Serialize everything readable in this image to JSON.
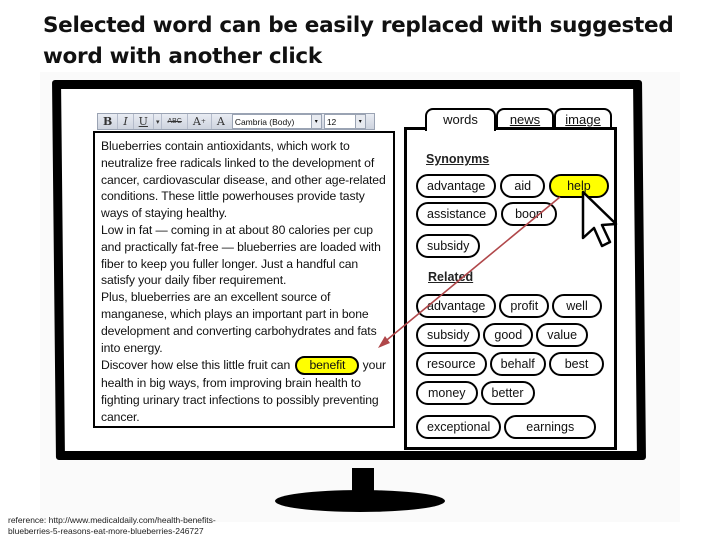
{
  "title": "Selected word can be easily replaced with suggested word with another click",
  "toolbar": {
    "bold": "B",
    "italic": "I",
    "underline": "U",
    "underline_dropdown": "▾",
    "strikethrough": "ABC",
    "grow_font": "A",
    "font_color": "A",
    "font_name": "Cambria (Body)",
    "font_size": "12",
    "dropdown_arrow": "▾"
  },
  "editor": {
    "paragraphs": [
      "Blueberries contain antioxidants, which work to neutralize free radicals linked to the development of cancer, cardiovascular disease, and other age-related conditions. These little powerhouses provide tasty ways of staying healthy.",
      "Low in fat — coming in at about 80 calories per cup and practically fat-free — blueberries are loaded with fiber to keep you fuller longer. Just a handful can satisfy your daily fiber requirement.",
      "Plus, blueberries are an excellent source of manganese, which plays an important part in bone development and converting carbohydrates and fats into energy."
    ],
    "last_before": "Discover how else this little fruit can",
    "selected_word": "benefit",
    "last_after": "your health in big ways, from improving brain health to fighting urinary tract infections to possibly preventing cancer."
  },
  "panel": {
    "tabs": [
      {
        "label": "words",
        "active": true
      },
      {
        "label": "news",
        "active": false
      },
      {
        "label": "image",
        "active": false
      }
    ],
    "synonyms_heading": "Synonyms",
    "synonyms": [
      {
        "label": "advantage",
        "selected": false
      },
      {
        "label": "aid",
        "selected": false
      },
      {
        "label": "help",
        "selected": true
      },
      {
        "label": "assistance",
        "selected": false
      },
      {
        "label": "boon",
        "selected": false
      },
      {
        "label": "subsidy",
        "selected": false
      }
    ],
    "related_heading": "Related",
    "related": [
      {
        "label": "advantage"
      },
      {
        "label": "profit"
      },
      {
        "label": "well"
      },
      {
        "label": "subsidy"
      },
      {
        "label": "good"
      },
      {
        "label": "value"
      },
      {
        "label": "resource"
      },
      {
        "label": "behalf"
      },
      {
        "label": "best"
      },
      {
        "label": "money"
      },
      {
        "label": "better"
      },
      {
        "label": "exceptional"
      },
      {
        "label": "earnings"
      }
    ]
  },
  "colors": {
    "highlight": "#ffff00",
    "arrow": "#b0474a"
  },
  "reference": {
    "line1": "reference: http://www.medicaldaily.com/health-benefits-",
    "line2": "blueberries-5-reasons-eat-more-blueberries-246727"
  }
}
